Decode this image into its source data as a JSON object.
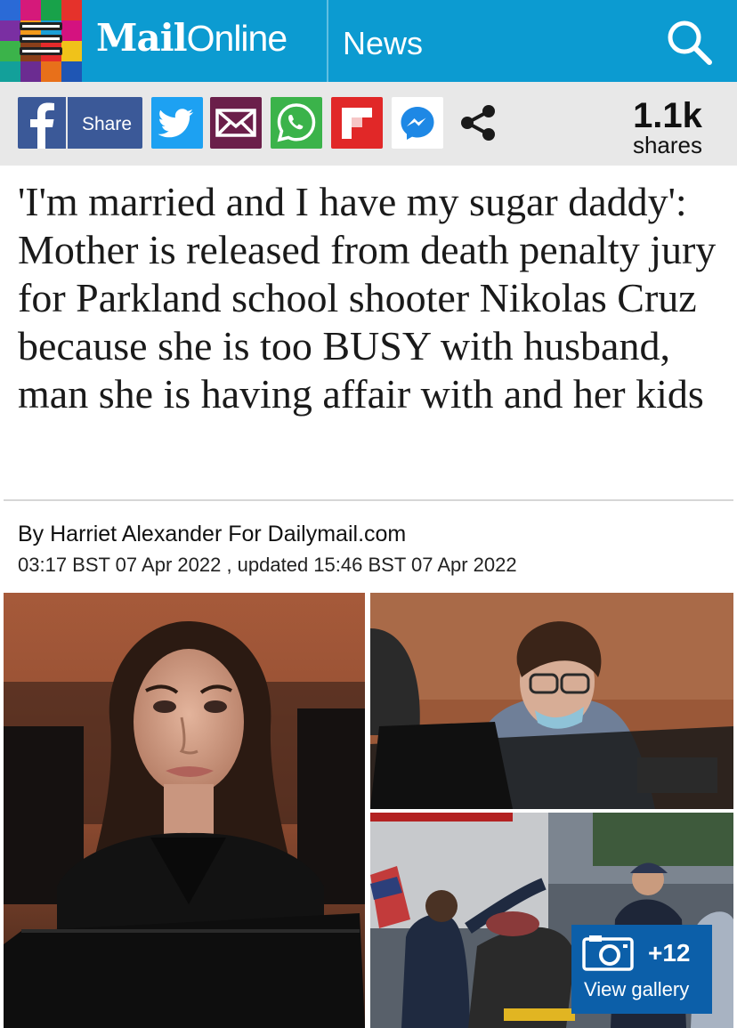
{
  "header": {
    "brand_bold": "Mail",
    "brand_light": "Online",
    "section": "News",
    "menu_colors": [
      "#2a6ad6",
      "#d5197a",
      "#18a24a",
      "#e5322b",
      "#7a2fa2",
      "#f39a1b",
      "#1b9fd6",
      "#d4127f",
      "#3bb34a",
      "#8a3f1a",
      "#e52b2b",
      "#f0c21a",
      "#13a09a",
      "#6b2c91",
      "#e8701a",
      "#1f56b4"
    ],
    "accent": "#0c9bd1"
  },
  "share": {
    "facebook_label": "Share",
    "icons": [
      "facebook-icon",
      "twitter-icon",
      "email-icon",
      "whatsapp-icon",
      "flipboard-icon",
      "messenger-icon",
      "share-icon"
    ],
    "count": "1.1k",
    "count_label": "shares"
  },
  "article": {
    "headline": "'I'm married and I have my sugar daddy': Mother is released from death penalty jury for Parkland school shooter Nikolas Cruz because she is too BUSY with husband, man she is having affair with and her kids",
    "byline": "By Harriet Alexander For Dailymail.com",
    "dateline": "03:17 BST 07 Apr 2022 , updated 15:46 BST 07 Apr 2022"
  },
  "gallery": {
    "count": "+12",
    "label": "View gallery"
  }
}
